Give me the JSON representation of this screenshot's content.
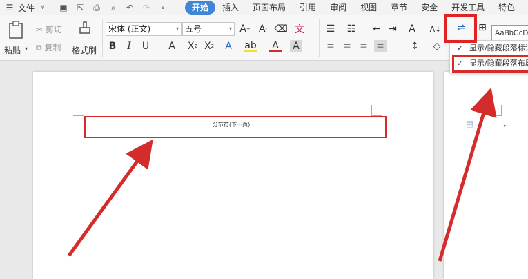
{
  "menubar": {
    "file_label": "文件",
    "tabs": [
      "开始",
      "插入",
      "页面布局",
      "引用",
      "审阅",
      "视图",
      "章节",
      "安全",
      "开发工具",
      "特色"
    ]
  },
  "ribbon": {
    "paste_label": "粘贴",
    "cut_label": "剪切",
    "copy_label": "复制",
    "format_painter_label": "格式刷",
    "font_name": "宋体 (正文)",
    "font_size": "五号",
    "style_preview": "AaBbCcD"
  },
  "dropdown": {
    "item1": "显示/隐藏段落标记",
    "item2": "显示/隐藏段落布局"
  },
  "document": {
    "section_break_label": "分节符(下一页)"
  },
  "colors": {
    "highlight": "#d42b2b",
    "accent": "#3f86d9"
  }
}
